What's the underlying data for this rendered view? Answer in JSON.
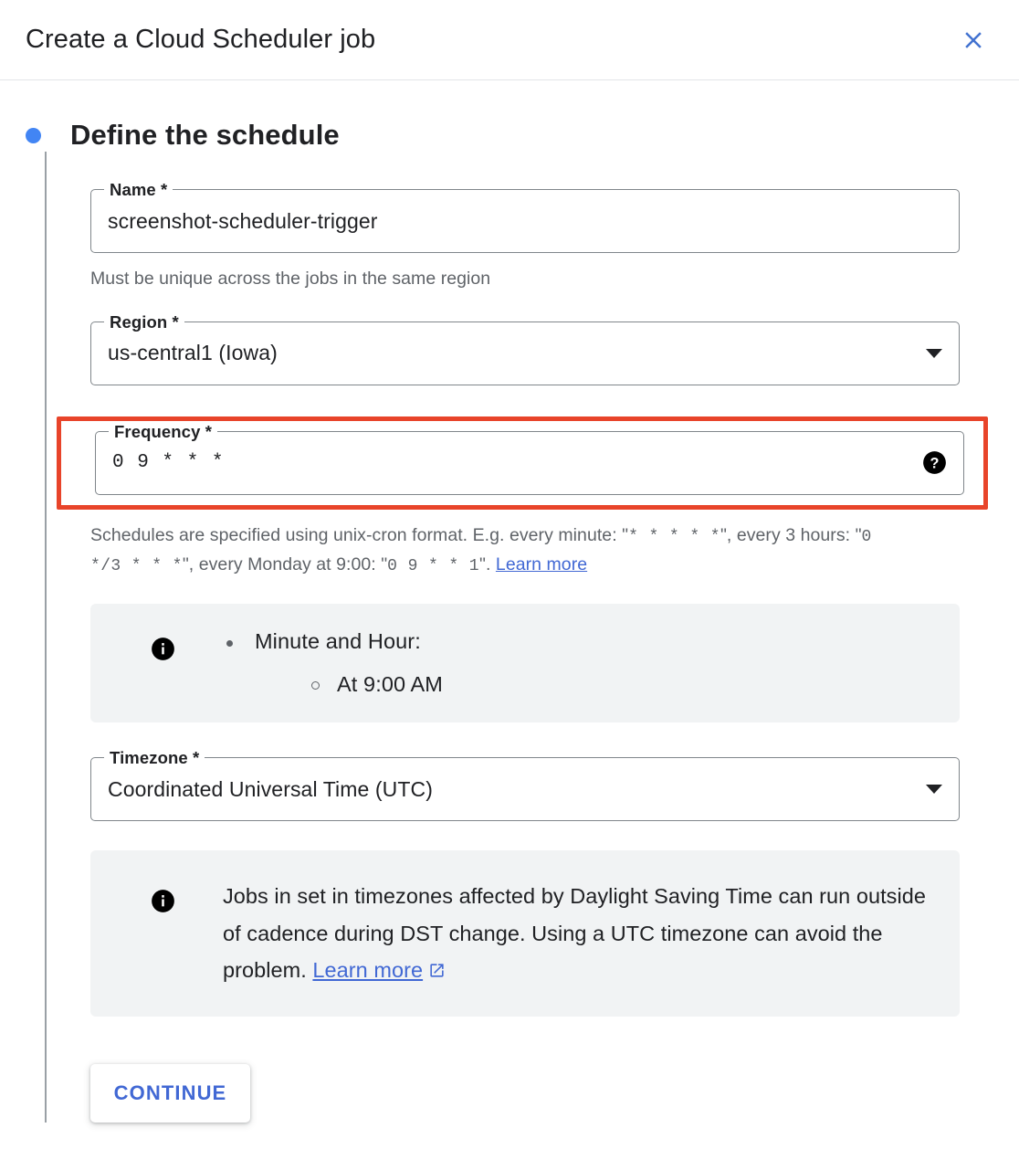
{
  "header": {
    "title": "Create a Cloud Scheduler job",
    "close_icon": "close-icon"
  },
  "step": {
    "title": "Define the schedule",
    "bullet_color": "#4285f4"
  },
  "fields": {
    "name": {
      "label": "Name *",
      "value": "screenshot-scheduler-trigger",
      "hint": "Must be unique across the jobs in the same region"
    },
    "region": {
      "label": "Region *",
      "value": "us-central1 (Iowa)",
      "caret_icon": "chevron-down-icon"
    },
    "frequency": {
      "label": "Frequency *",
      "value": "0 9 * * *",
      "help_icon": "help-circle-icon",
      "highlight_color": "#e8442a",
      "hint_part1": "Schedules are specified using unix-cron format. E.g. every minute: \"",
      "hint_cron1": "*  *  *  *  *",
      "hint_part2": "\", every 3 hours: \"",
      "hint_cron2": "0  */3  *  *  *",
      "hint_part3": "\", every Monday at 9:00: \"",
      "hint_cron3": "0  9  *  *  1",
      "hint_part4": "\". ",
      "hint_link": "Learn more"
    },
    "timezone": {
      "label": "Timezone *",
      "value": "Coordinated Universal Time (UTC)",
      "caret_icon": "chevron-down-icon"
    }
  },
  "schedule_info": {
    "icon": "info-circle-icon",
    "item": "Minute and Hour:",
    "subitem": "At 9:00 AM"
  },
  "dst_info": {
    "icon": "info-circle-icon",
    "text": "Jobs in set in timezones affected by Daylight Saving Time can run outside of cadence during DST change. Using a UTC timezone can avoid the problem. ",
    "link": "Learn more",
    "link_icon": "open-in-new-icon"
  },
  "actions": {
    "continue_label": "CONTINUE"
  }
}
